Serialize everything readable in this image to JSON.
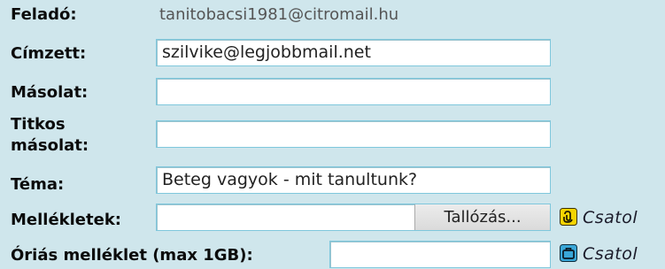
{
  "form": {
    "from": {
      "label": "Feladó:",
      "value": "tanitobacsi1981@citromail.hu"
    },
    "to": {
      "label": "Címzett:",
      "value": "szilvike@legjobbmail.net"
    },
    "cc": {
      "label": "Másolat:",
      "value": ""
    },
    "bcc": {
      "label_line1": "Titkos",
      "label_line2": "másolat:",
      "value": ""
    },
    "subject": {
      "label": "Téma:",
      "value": "Beteg vagyok - mit tanultunk?"
    },
    "attachments": {
      "label": "Mellékletek:",
      "browse_label": "Tallózás...",
      "attach_label": "Csatol",
      "icon": "paperclip-icon"
    },
    "big_attachment": {
      "label": "Óriás melléklet (max 1GB):",
      "attach_label": "Csatol",
      "icon": "briefcase-icon"
    }
  },
  "colors": {
    "background": "#cfe6ec",
    "field_border": "#7fc7dc",
    "paperclip_icon_bg": "#f4d400",
    "briefcase_icon_bg": "#3aa7d8"
  }
}
